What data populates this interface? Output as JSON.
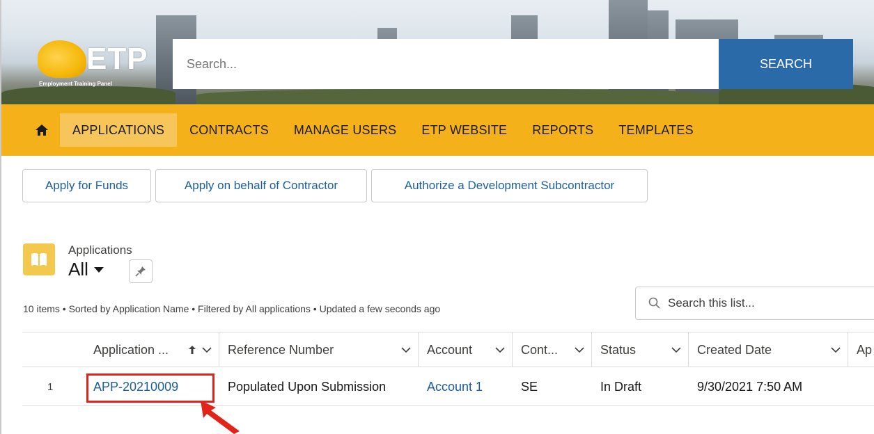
{
  "header": {
    "logo_text": "ETP",
    "logo_subtitle": "Employment Training Panel",
    "search_placeholder": "Search...",
    "search_button": "SEARCH"
  },
  "nav": {
    "home_icon": "home-icon",
    "items": [
      {
        "label": "APPLICATIONS",
        "active": true
      },
      {
        "label": "CONTRACTS",
        "active": false
      },
      {
        "label": "MANAGE USERS",
        "active": false
      },
      {
        "label": "ETP WEBSITE",
        "active": false
      },
      {
        "label": "REPORTS",
        "active": false
      },
      {
        "label": "TEMPLATES",
        "active": false
      }
    ]
  },
  "actions": {
    "apply_funds": "Apply for Funds",
    "apply_behalf": "Apply on behalf of Contractor",
    "authorize_sub": "Authorize a Development Subcontractor"
  },
  "list": {
    "object_label": "Applications",
    "view_name": "All",
    "meta": "10 items • Sorted by Application Name • Filtered by All applications • Updated a few seconds ago",
    "search_placeholder": "Search this list...",
    "columns": [
      {
        "label": "Application ..."
      },
      {
        "label": "Reference Number"
      },
      {
        "label": "Account"
      },
      {
        "label": "Cont..."
      },
      {
        "label": "Status"
      },
      {
        "label": "Created Date"
      },
      {
        "label": "Ap"
      }
    ],
    "rows": [
      {
        "num": "1",
        "application": "APP-20210009",
        "reference": "Populated Upon Submission",
        "account": "Account 1",
        "contract": "SE",
        "status": "In Draft",
        "created": "9/30/2021 7:50 AM"
      }
    ]
  },
  "colors": {
    "nav_bg": "#f5b119",
    "nav_active": "#f7c65a",
    "search_button": "#2a6aa8",
    "link": "#1b5e9e",
    "highlight": "#e2231a"
  }
}
